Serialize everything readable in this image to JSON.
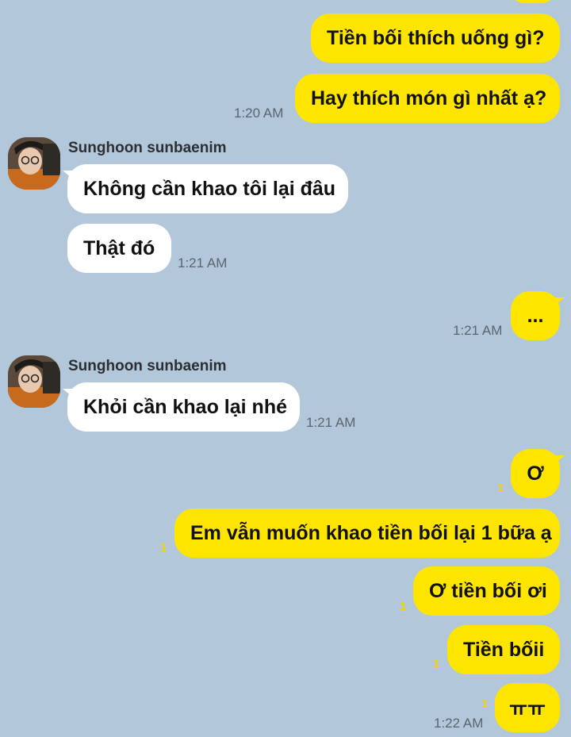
{
  "colors": {
    "background": "#b2c7da",
    "my_bubble": "#fee500",
    "their_bubble": "#ffffff",
    "unread": "#f1d600"
  },
  "messages": {
    "m1": "Tiền bối thích uống gì?",
    "m2": "Hay thích món gì nhất ạ?",
    "m2_time": "1:20 AM",
    "sender1": "Sunghoon sunbaenim",
    "m3": "Không cần khao tôi lại đâu",
    "m4": "Thật đó",
    "m4_time": "1:21 AM",
    "m5": "...",
    "m5_time": "1:21 AM",
    "sender2": "Sunghoon sunbaenim",
    "m6": "Khỏi cần khao lại nhé",
    "m6_time": "1:21 AM",
    "m7": "Ơ",
    "m7_unread": "1",
    "m8": "Em vẫn muốn khao tiền bối lại 1 bữa ạ",
    "m8_unread": "1",
    "m9": "Ơ tiền bối ơi",
    "m9_unread": "1",
    "m10": "Tiền bốii",
    "m10_unread": "1",
    "m11": "ㅠㅠ",
    "m11_unread": "1",
    "m11_time": "1:22 AM"
  },
  "icons": {
    "avatar": "profile-photo"
  }
}
